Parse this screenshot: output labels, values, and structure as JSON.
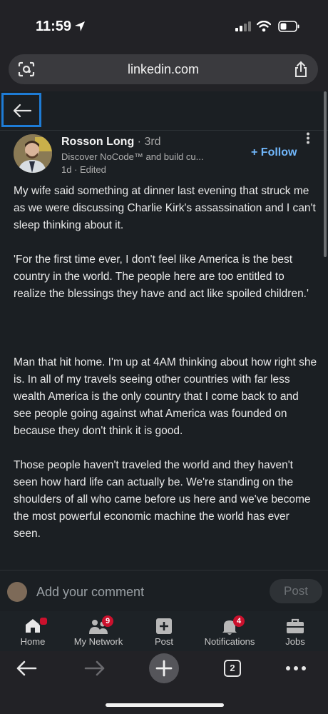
{
  "status_bar": {
    "time": "11:59"
  },
  "browser": {
    "url": "linkedin.com",
    "tabs_count": "2"
  },
  "post": {
    "author_name": "Rosson Long",
    "connection_degree": "· 3rd",
    "headline": "Discover NoCode™ and build cu...",
    "meta": "1d · Edited",
    "follow_label": "Follow",
    "paragraphs": [
      "My wife said something at dinner last evening that struck me as we were discussing Charlie Kirk's assassination and I can't sleep thinking about it.",
      "'For the first time ever, I don't feel like America is the best country in the world. The people here are too entitled to realize the blessings they have and act like spoiled children.'",
      "Man that hit home. I'm up at 4AM thinking about how right she is. In all of my travels seeing other countries with far less wealth America is the only country that I come back to and see people going against what America was founded on because they don't think it is good.",
      "Those people haven't traveled the world and they haven't seen how hard life can actually be. We're standing on the shoulders of all who came before us here and we've become the most powerful economic machine the world has ever seen."
    ]
  },
  "comment": {
    "placeholder": "Add your comment",
    "post_label": "Post"
  },
  "nav": {
    "home": "Home",
    "network": "My Network",
    "network_badge": "9",
    "post": "Post",
    "notifications": "Notifications",
    "notifications_badge": "4",
    "jobs": "Jobs"
  },
  "colors": {
    "background": "#1b1f23",
    "accent": "#71b7fb",
    "badge": "#cb112d",
    "focus_outline": "#1e7cd6"
  }
}
